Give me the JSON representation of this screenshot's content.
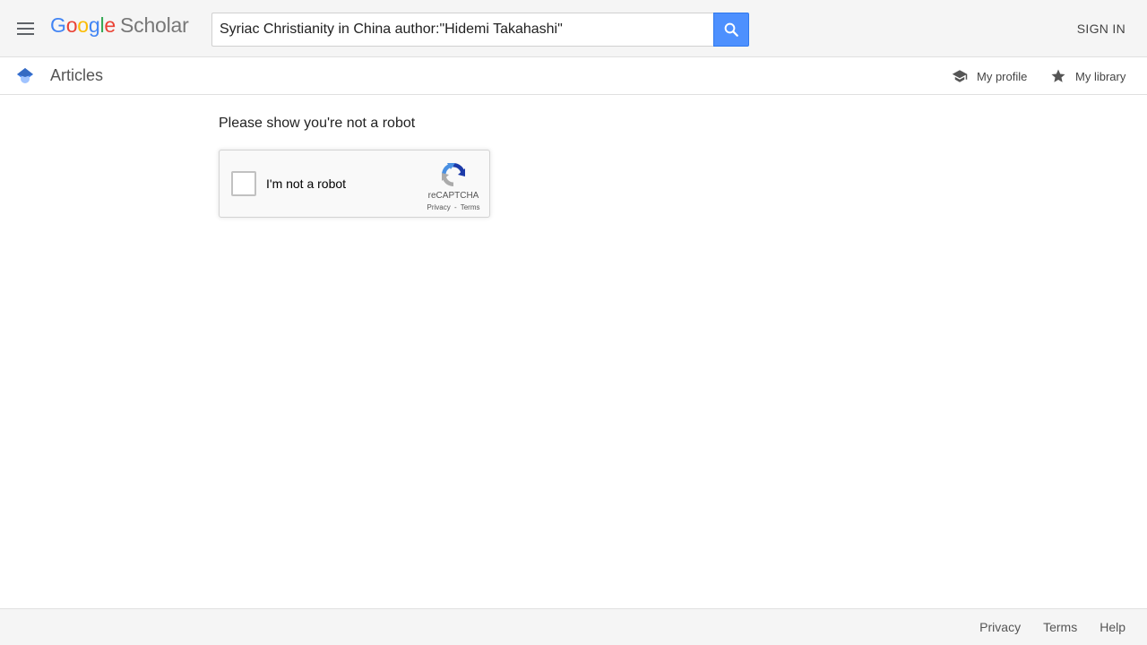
{
  "header": {
    "logo": {
      "letters": [
        "G",
        "o",
        "o",
        "g",
        "l",
        "e"
      ],
      "product": "Scholar"
    },
    "search": {
      "value": "Syriac Christianity in China author:\"Hidemi Takahashi\""
    },
    "sign_in": "SIGN IN"
  },
  "subbar": {
    "section": "Articles",
    "my_profile": "My profile",
    "my_library": "My library"
  },
  "main": {
    "prompt": "Please show you're not a robot",
    "recaptcha": {
      "label": "I'm not a robot",
      "brand": "reCAPTCHA",
      "privacy": "Privacy",
      "separator": "-",
      "terms": "Terms"
    }
  },
  "footer": {
    "links": [
      "Privacy",
      "Terms",
      "Help"
    ]
  },
  "colors": {
    "google_blue": "#4285f4",
    "google_red": "#ea4335",
    "google_yellow": "#fbbc05",
    "google_green": "#34a853",
    "search_button": "#4d90fe"
  },
  "icons": [
    "menu-icon",
    "search-icon",
    "scholar-cap-icon",
    "graduation-cap-icon",
    "star-icon",
    "recaptcha-logo-icon"
  ]
}
